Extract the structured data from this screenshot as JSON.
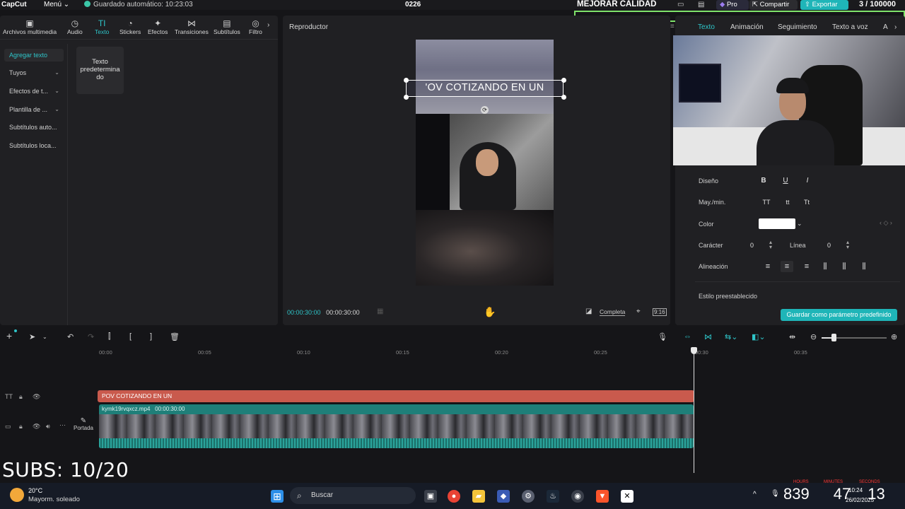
{
  "topbar": {
    "app": "CapCut",
    "menu": "Menú",
    "autosave": "Guardado automático: 10:23:03",
    "project": "0226",
    "quality": "MEJORAR CALIDAD",
    "pro": "Pro",
    "share": "Compartir",
    "export": "Exportar",
    "counter": "3 / 100000"
  },
  "tools": [
    {
      "icon": "▣",
      "label": "Archivos multimedia"
    },
    {
      "icon": "◷",
      "label": "Audio"
    },
    {
      "icon": "TI",
      "label": "Texto"
    },
    {
      "icon": "◔",
      "label": "Stickers"
    },
    {
      "icon": "✦",
      "label": "Efectos"
    },
    {
      "icon": "⋈",
      "label": "Transiciones"
    },
    {
      "icon": "▤",
      "label": "Subtítulos"
    },
    {
      "icon": "◎",
      "label": "Filtro"
    }
  ],
  "text_categories": [
    {
      "label": "Agregar texto"
    },
    {
      "label": "Tuyos",
      "chev": "⌄"
    },
    {
      "label": "Efectos de t...",
      "chev": "⌄"
    },
    {
      "label": "Plantilla de ...",
      "chev": "⌄"
    },
    {
      "label": "Subtítulos auto..."
    },
    {
      "label": "Subtítulos loca..."
    }
  ],
  "text_card": "Texto predetermina do",
  "player": {
    "title": "Reproductor",
    "overlay_text": "'OV COTIZANDO EN UN",
    "time_current": "00:00:30:00",
    "time_total": "00:00:30:00",
    "ratio_mode": "Completa",
    "aspect": "9:16"
  },
  "right_tabs": [
    "Texto",
    "Animación",
    "Seguimiento",
    "Texto a voz",
    "A"
  ],
  "props": {
    "design": "Diseño",
    "case": "May./min.",
    "color": "Color",
    "char": "Carácter",
    "char_val": "0",
    "line": "Línea",
    "line_val": "0",
    "align": "Alineación",
    "preset": "Estilo preestablecido",
    "save_btn": "Guardar como parámetro predefinido",
    "bold": "B",
    "underline": "U",
    "italic": "I",
    "upper": "TT",
    "lower": "tt",
    "title": "Tt"
  },
  "ruler": [
    "00:00",
    "00:05",
    "00:10",
    "00:15",
    "00:20",
    "00:25",
    "00:30",
    "00:35"
  ],
  "tracks": {
    "text_clip": "POV COTIZANDO EN UN",
    "video_name": "kymk19rvqxcz.mp4",
    "video_dur": "00:00:30:00",
    "cover": "Portada"
  },
  "subs": "SUBS: 10/20",
  "taskbar": {
    "temp": "20°C",
    "weather": "Mayorm. soleado",
    "search": "Buscar",
    "overlay_h": "839",
    "overlay_m": "47",
    "overlay_s": "13",
    "lbl_hours": "HOURS",
    "lbl_min": "MINUTES",
    "lbl_sec": "SECONDS",
    "time": "10:24",
    "date": "26/02/2025"
  }
}
